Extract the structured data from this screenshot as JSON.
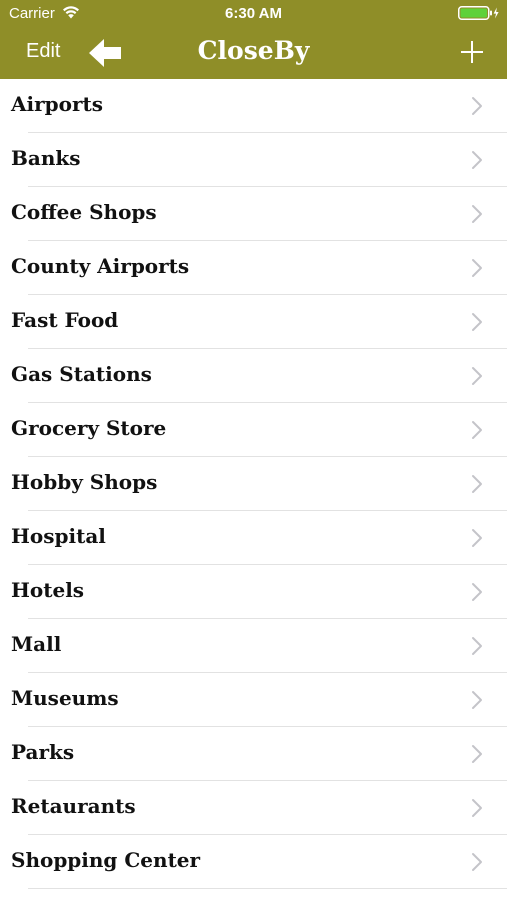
{
  "status_bar": {
    "carrier": "Carrier",
    "time": "6:30 AM",
    "battery_color": "#5fd13a"
  },
  "nav": {
    "edit_label": "Edit",
    "title": "CloseBy",
    "back_icon": "arrow-left-icon",
    "add_icon": "plus-icon",
    "bar_color": "#8f8e28"
  },
  "list": {
    "items": [
      {
        "label": "Airports"
      },
      {
        "label": "Banks"
      },
      {
        "label": "Coffee Shops"
      },
      {
        "label": "County Airports"
      },
      {
        "label": "Fast Food"
      },
      {
        "label": "Gas Stations"
      },
      {
        "label": "Grocery Store"
      },
      {
        "label": "Hobby Shops"
      },
      {
        "label": "Hospital"
      },
      {
        "label": "Hotels"
      },
      {
        "label": "Mall"
      },
      {
        "label": "Museums"
      },
      {
        "label": "Parks"
      },
      {
        "label": "Retaurants"
      },
      {
        "label": "Shopping Center"
      }
    ]
  }
}
